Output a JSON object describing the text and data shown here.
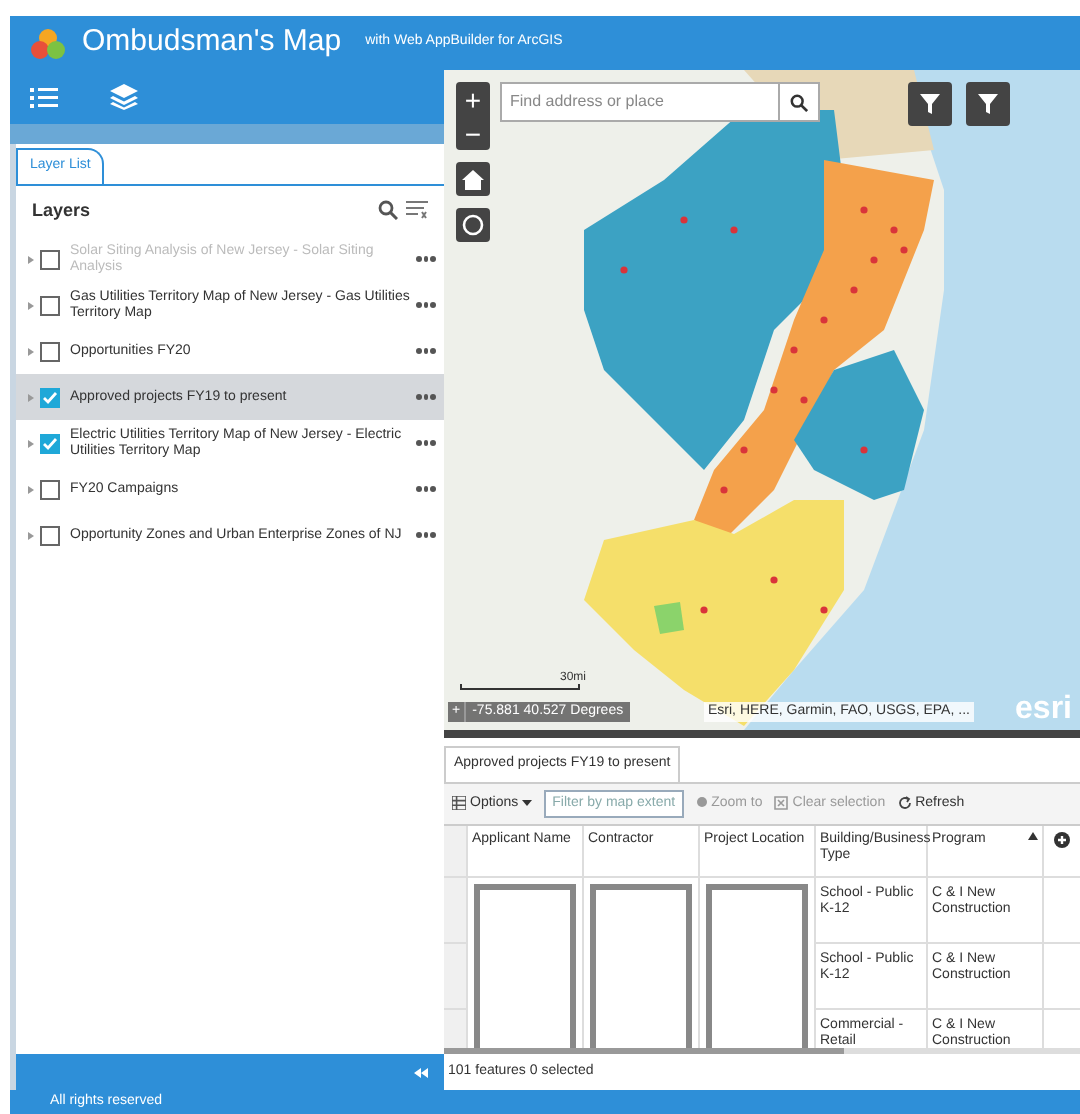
{
  "header": {
    "title": "Ombudsman's Map",
    "subtitle": "with Web AppBuilder for ArcGIS"
  },
  "panel_tabs": [
    {
      "label": "Layer List",
      "selected": true
    }
  ],
  "layers_panel": {
    "title": "Layers",
    "items": [
      {
        "label": "Solar Siting Analysis of New Jersey - Solar Siting Analysis",
        "checked": false,
        "selected": false,
        "dimmed": true
      },
      {
        "label": "Gas Utilities Territory Map of New Jersey - Gas Utilities Territory Map",
        "checked": false,
        "selected": false,
        "dimmed": false
      },
      {
        "label": "Opportunities FY20",
        "checked": false,
        "selected": false,
        "dimmed": false
      },
      {
        "label": "Approved projects FY19 to present",
        "checked": true,
        "selected": true,
        "dimmed": false
      },
      {
        "label": "Electric Utilities Territory Map of New Jersey - Electric Utilities Territory Map",
        "checked": true,
        "selected": false,
        "dimmed": false
      },
      {
        "label": "FY20 Campaigns",
        "checked": false,
        "selected": false,
        "dimmed": false
      },
      {
        "label": "Opportunity Zones and Urban Enterprise Zones of NJ",
        "checked": false,
        "selected": false,
        "dimmed": false
      }
    ]
  },
  "map": {
    "zoom_in": "+",
    "zoom_out": "−",
    "search_placeholder": "Find address or place",
    "scale": "30mi",
    "coordinates": "-75.881 40.527 Degrees",
    "coordinates_toggle": "+",
    "attribution": "Esri, HERE, Garmin, FAO, USGS, EPA, ...",
    "logo": "esri"
  },
  "table": {
    "tab": "Approved projects FY19 to present",
    "options": "Options",
    "filter": "Filter by map extent",
    "zoom_to": "Zoom to",
    "clear_selection": "Clear selection",
    "refresh": "Refresh",
    "columns": [
      "Applicant Name",
      "Contractor",
      "Project Location",
      "Building/Business Type",
      "Program"
    ],
    "rows": [
      {
        "building_type": "School - Public K-12",
        "program": "C & I New Construction"
      },
      {
        "building_type": "School - Public K-12",
        "program": "C & I New Construction"
      },
      {
        "building_type": "Commercial - Retail",
        "program": "C & I New Construction"
      }
    ],
    "status": "101 features 0 selected"
  },
  "footer": "All rights reserved"
}
